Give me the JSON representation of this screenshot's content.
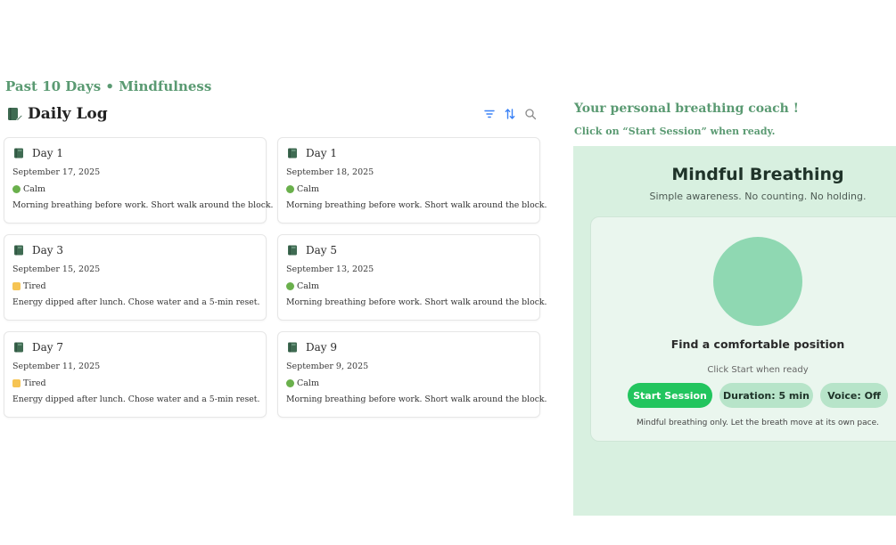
{
  "section_title": "Past 10 Days • Mindfulness",
  "log": {
    "title": "Daily Log",
    "icon": "journal-pen-icon",
    "tools": [
      "filter-icon",
      "sort-icon",
      "search-icon"
    ]
  },
  "cards": [
    {
      "title": "Day 1",
      "date": "September 17, 2025",
      "mood": "Calm",
      "mood_color": "#6ab04c",
      "mood_shape": "dot",
      "note": "Morning breathing before work. Short walk around the block."
    },
    {
      "title": "Day 1",
      "date": "September 18, 2025",
      "mood": "Calm",
      "mood_color": "#6ab04c",
      "mood_shape": "dot",
      "note": "Morning breathing before work. Short walk around the block."
    },
    {
      "title": "Day 3",
      "date": "September 15, 2025",
      "mood": "Tired",
      "mood_color": "#f6c453",
      "mood_shape": "square",
      "note": "Energy dipped after lunch. Chose water and a 5-min reset."
    },
    {
      "title": "Day 5",
      "date": "September 13, 2025",
      "mood": "Calm",
      "mood_color": "#6ab04c",
      "mood_shape": "dot",
      "note": "Morning breathing before work. Short walk around the block."
    },
    {
      "title": "Day 7",
      "date": "September 11, 2025",
      "mood": "Tired",
      "mood_color": "#f6c453",
      "mood_shape": "square",
      "note": "Energy dipped after lunch. Chose water and a 5-min reset."
    },
    {
      "title": "Day 9",
      "date": "September 9, 2025",
      "mood": "Calm",
      "mood_color": "#6ab04c",
      "mood_shape": "dot",
      "note": "Morning breathing before work. Short walk around the block."
    }
  ],
  "coach": {
    "title": "Your personal breathing coach !",
    "subtitle": "Click on “Start Session” when ready."
  },
  "session": {
    "title": "Mindful Breathing",
    "subtitle": "Simple awareness. No counting. No holding.",
    "heading": "Find a comfortable position",
    "hint": "Click Start when ready",
    "start_label": "Start Session",
    "duration_label": "Duration: 5 min",
    "voice_label": "Voice: Off",
    "footnote": "Mindful breathing only. Let the breath move at its own pace."
  },
  "colors": {
    "accent_green": "#5a9a72",
    "primary_button": "#22c55e",
    "panel_bg": "#d8f0e0",
    "circle": "#8fd8b2",
    "tool_blue": "#3b82f6"
  }
}
